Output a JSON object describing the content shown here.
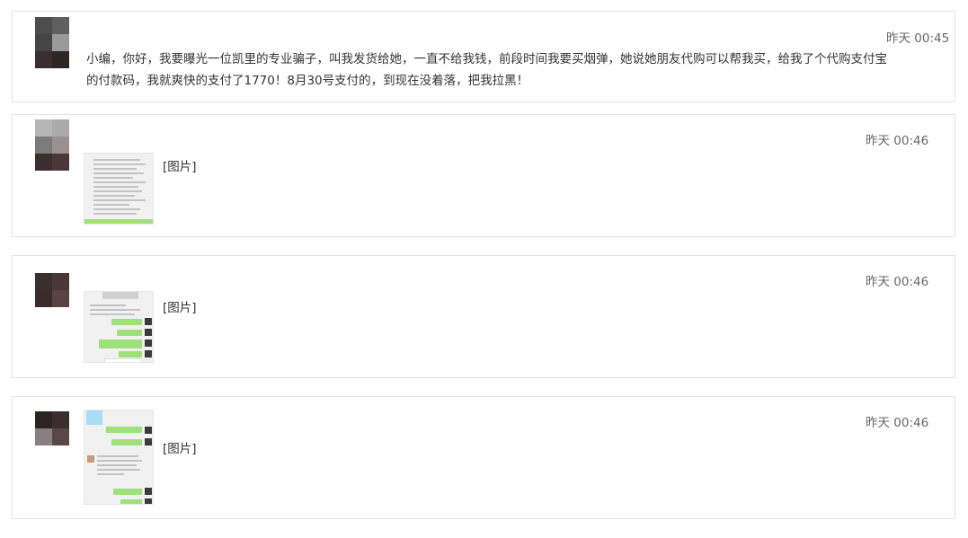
{
  "messages": [
    {
      "timestamp": "昨天 00:45",
      "text": "小编，你好，我要曝光一位凯里的专业骗子，叫我发货给她，一直不给我钱，前段时间我要买烟弹，她说她朋友代购可以帮我买，给我了个代购支付宝的付款码，我就爽快的支付了1770！8月30号支付的，到现在没着落，把我拉黑！"
    },
    {
      "timestamp": "昨天 00:46",
      "image_label": "[图片]"
    },
    {
      "timestamp": "昨天 00:46",
      "image_label": "[图片]"
    },
    {
      "timestamp": "昨天 00:46",
      "image_label": "[图片]"
    }
  ],
  "colors": {
    "card_border": "#e4e4e4",
    "text": "#333333",
    "timestamp": "#666666",
    "chat_green": "#9fe07a"
  }
}
